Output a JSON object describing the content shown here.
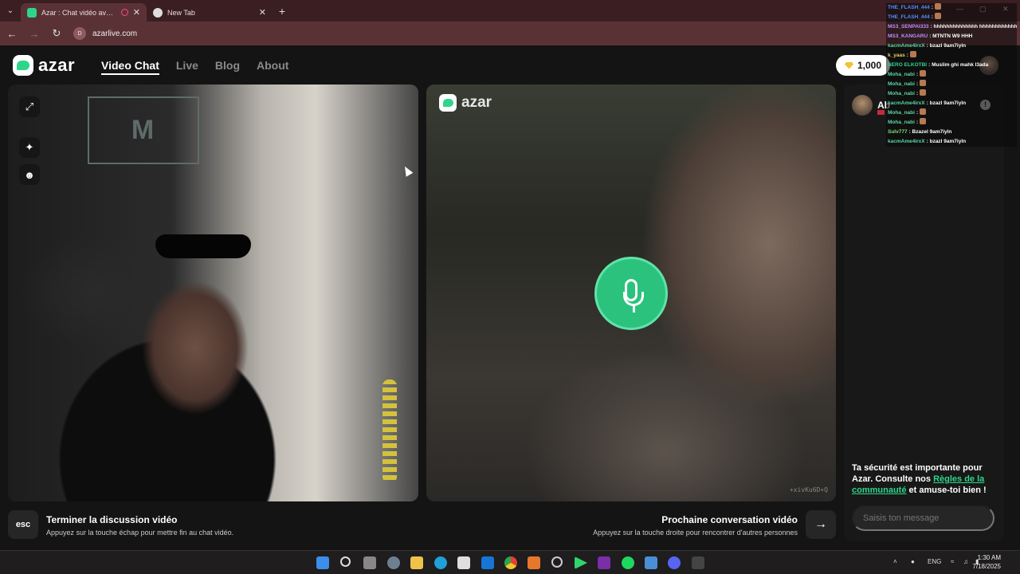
{
  "browser": {
    "tabs": [
      {
        "title": "Azar : Chat vidéo avec de n",
        "active": true
      },
      {
        "title": "New Tab",
        "active": false
      }
    ],
    "new_tab": "+",
    "address": "azarlive.com",
    "site_badge": "D"
  },
  "header": {
    "logo_text": "azar",
    "nav": [
      "Video Chat",
      "Live",
      "Blog",
      "About"
    ],
    "gems": "1,000"
  },
  "remote": {
    "logo_text": "azar",
    "session_id": "+xivKu6D+Q"
  },
  "chat": {
    "peer_name": "Ab",
    "report_symbol": "!",
    "safety_prefix": "Ta sécurité est importante pour Azar. Consulte nos ",
    "safety_link": "Règles de la communauté",
    "safety_suffix": " et amuse-toi bien !",
    "input_placeholder": "Saisis ton message"
  },
  "controls": {
    "esc_key": "esc",
    "end_title": "Terminer la discussion vidéo",
    "end_sub": "Appuyez sur la touche échap pour mettre fin au chat vidéo.",
    "next_title": "Prochaine conversation vidéo",
    "next_sub": "Appuyez sur la touche droite pour rencontrer d'autres personnes",
    "next_arrow": "→"
  },
  "stream_chat": [
    {
      "user": "THE_FLASH_444",
      "color": "#4f8dff",
      "text": ":",
      "emote": true
    },
    {
      "user": "THE_FLASH_444",
      "color": "#4f8dff",
      "text": ":",
      "emote": true
    },
    {
      "user": "MS3_SENPAI333",
      "color": "#c08bff",
      "text": ": hhhhhhhhhhhhhh hhhhhhhhhhhhh",
      "emote": false
    },
    {
      "user": "MS3_KANGARU",
      "color": "#c08bff",
      "text": ": MTNTN W9 HHH",
      "emote": false
    },
    {
      "user": "kacmAme4irxX",
      "color": "#5bd6a4",
      "text": ": bzazl 9am7iyln",
      "emote": false
    },
    {
      "user": "k_yaas",
      "color": "#e8d060",
      "text": ":",
      "emote": true
    },
    {
      "user": "NERO ELKOTBI",
      "color": "#2fd58b",
      "text": ": Muslim ghi mahk l3ada",
      "emote": false
    },
    {
      "user": "Moha_nabi",
      "color": "#5bd6a4",
      "text": ":",
      "emote": true
    },
    {
      "user": "Moha_nabi",
      "color": "#5bd6a4",
      "text": ":",
      "emote": true
    },
    {
      "user": "Moha_nabi",
      "color": "#5bd6a4",
      "text": ":",
      "emote": true
    },
    {
      "user": "kacmAme4irxX",
      "color": "#5bd6a4",
      "text": ": bzazl 9am7iyln",
      "emote": false
    },
    {
      "user": "Moha_nabi",
      "color": "#5bd6a4",
      "text": ":",
      "emote": true
    },
    {
      "user": "Moha_nabi",
      "color": "#5bd6a4",
      "text": ":",
      "emote": true
    },
    {
      "user": "Sulv777",
      "color": "#7fe07f",
      "text": ": Bzazel 9am7iyln",
      "emote": false
    },
    {
      "user": "kacmAme4irxX",
      "color": "#5bd6a4",
      "text": ": bzazl 9am7iyln",
      "emote": false
    }
  ],
  "taskbar": {
    "language": "ENG",
    "time": "1:30 AM",
    "date": "7/18/2025"
  }
}
